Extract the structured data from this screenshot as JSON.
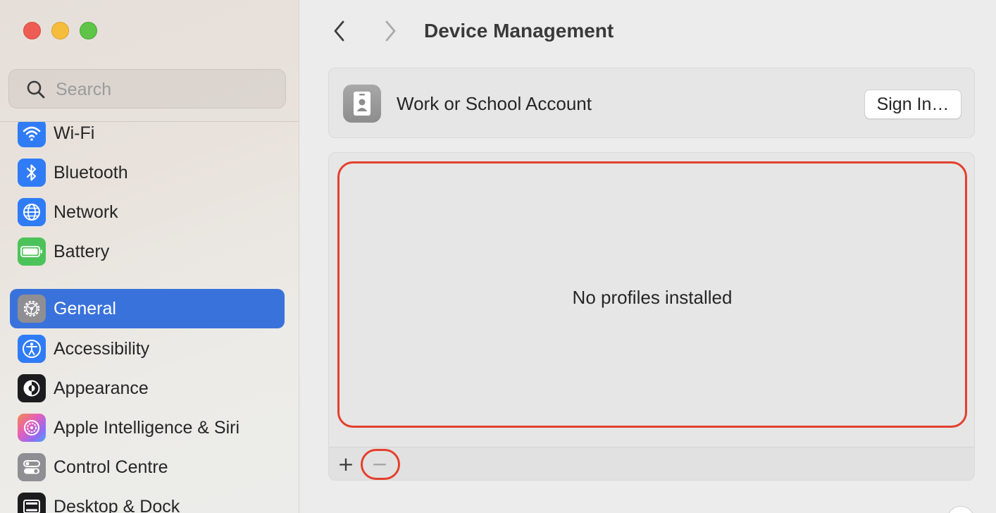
{
  "window": {
    "controls": [
      "close",
      "minimize",
      "zoom"
    ]
  },
  "sidebar": {
    "search": {
      "placeholder": "Search",
      "value": ""
    },
    "items": [
      {
        "label": "Wi-Fi",
        "icon": "wifi-icon",
        "color": "#2f7cf6",
        "active": false
      },
      {
        "label": "Bluetooth",
        "icon": "bluetooth-icon",
        "color": "#2f7cf6",
        "active": false
      },
      {
        "label": "Network",
        "icon": "globe-icon",
        "color": "#2f7cf6",
        "active": false
      },
      {
        "label": "Battery",
        "icon": "battery-icon",
        "color": "#4cc35a",
        "active": false
      },
      {
        "label": "General",
        "icon": "gear-icon",
        "color": "#8e8e93",
        "active": true
      },
      {
        "label": "Accessibility",
        "icon": "accessibility-icon",
        "color": "#2f7cf6",
        "active": false
      },
      {
        "label": "Appearance",
        "icon": "appearance-icon",
        "color": "#1c1c1e",
        "active": false
      },
      {
        "label": "Apple Intelligence & Siri",
        "icon": "siri-icon",
        "color": "#c55cf0",
        "active": false
      },
      {
        "label": "Control Centre",
        "icon": "toggles-icon",
        "color": "#8e8e93",
        "active": false
      },
      {
        "label": "Desktop & Dock",
        "icon": "dock-icon",
        "color": "#1c1c1e",
        "active": false
      }
    ]
  },
  "header": {
    "title": "Device Management",
    "back": "chevron-left-icon",
    "forward": "chevron-right-icon"
  },
  "account": {
    "label": "Work or School Account",
    "button": "Sign In…",
    "icon": "id-badge-icon"
  },
  "profiles": {
    "empty_message": "No profiles installed",
    "add": "+",
    "remove": "−"
  },
  "colors": {
    "accent": "#3a72dc",
    "highlight": "#e3402d"
  }
}
